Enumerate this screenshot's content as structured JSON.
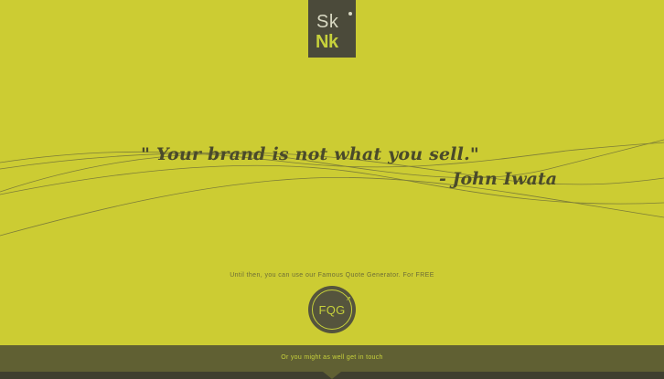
{
  "logo": {
    "line1": "Sk",
    "line2": "Nk",
    "mark": "logo-mark"
  },
  "quote": {
    "text": "\" Your brand is not what you sell.\"",
    "author": "- John Iwata"
  },
  "tagline": "Until then, you can use our Famous Quote Generator. For FREE",
  "fqg_button": {
    "label": "FQG",
    "icon": "refresh-arrow-icon"
  },
  "footer": {
    "text": "Or you might as well get in touch",
    "icon": "chevron-down-icon"
  },
  "colors": {
    "background": "#cccc33",
    "dark": "#4b4a3a",
    "accent": "#c7d13b",
    "footer": "#606033"
  }
}
